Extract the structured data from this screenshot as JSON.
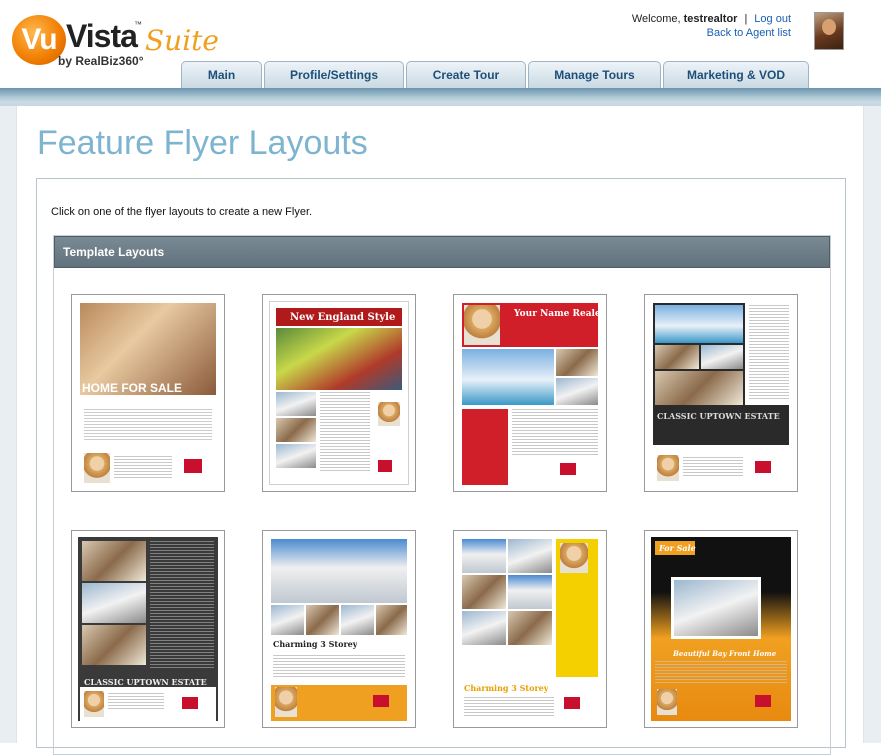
{
  "header": {
    "logo": {
      "vu": "Vu",
      "vista": "Vista",
      "tm": "™",
      "suite": "Suite",
      "by": "by RealBiz360°"
    },
    "welcome_prefix": "Welcome,",
    "username": "testrealtor",
    "separator": "|",
    "logout": "Log out",
    "back_to_agents": "Back to Agent list"
  },
  "nav": {
    "tabs": [
      {
        "label": "Main"
      },
      {
        "label": "Profile/Settings"
      },
      {
        "label": "Create Tour"
      },
      {
        "label": "Manage Tours"
      },
      {
        "label": "Marketing & VOD"
      }
    ]
  },
  "page": {
    "title": "Feature Flyer Layouts",
    "intro": "Click on one of the flyer layouts to create a new Flyer.",
    "section_title": "Template Layouts"
  },
  "layouts": [
    {
      "heading": "HOME FOR SALE"
    },
    {
      "heading": "New England Style"
    },
    {
      "heading": "Your Name Realestate"
    },
    {
      "heading": "CLASSIC UPTOWN ESTATE"
    },
    {
      "heading": "CLASSIC UPTOWN ESTATE"
    },
    {
      "heading": "Charming 3 Storey"
    },
    {
      "heading": "Charming 3 Storey"
    },
    {
      "heading": "For Sale",
      "subheading": "Beautiful Bay Front Home"
    }
  ],
  "colors": {
    "title": "#7db4cf",
    "tab_text": "#1e4f78",
    "panel_header": "#6b7b85",
    "link": "#1a5fb4"
  },
  "icons": {
    "avatar": "user-photo"
  }
}
